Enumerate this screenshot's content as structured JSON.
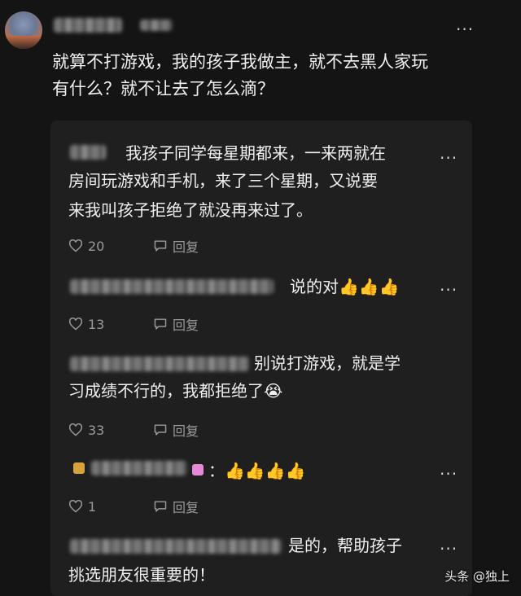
{
  "post": {
    "text_line1": "就算不打游戏，我的孩子我做主，就不去黑人家玩",
    "text_line2": "有什么？就不让去了怎么滴？"
  },
  "more_glyph": "···",
  "replies": [
    {
      "line1": "我孩子同学每星期都来，一来两就在",
      "line2": "房间玩游戏和手机，来了三个星期，又说要",
      "line3": "来我叫孩子拒绝了就没再来过了。",
      "likes": "20",
      "reply_label": "回复"
    },
    {
      "line1": "说的对👍👍👍",
      "likes": "13",
      "reply_label": "回复"
    },
    {
      "line1": "别说打游戏，就是学",
      "line2": "习成绩不行的，我都拒绝了😭",
      "likes": "33",
      "reply_label": "回复"
    },
    {
      "line1": "：👍👍👍👍",
      "likes": "1",
      "reply_label": "回复"
    },
    {
      "line1": "是的，帮助孩子",
      "line2": "挑选朋友很重要的！"
    }
  ],
  "watermark": "头条 @独上",
  "colors": {
    "background": "#141414",
    "panel": "#1f1f1f",
    "text": "#f0f0f0",
    "muted": "#9a9a9a",
    "thumbs": "#f5b52e",
    "badge_yellow": "#d6a23a",
    "badge_pink": "#e58ad6"
  },
  "icons": [
    "heart-icon",
    "comment-icon",
    "more-icon"
  ]
}
